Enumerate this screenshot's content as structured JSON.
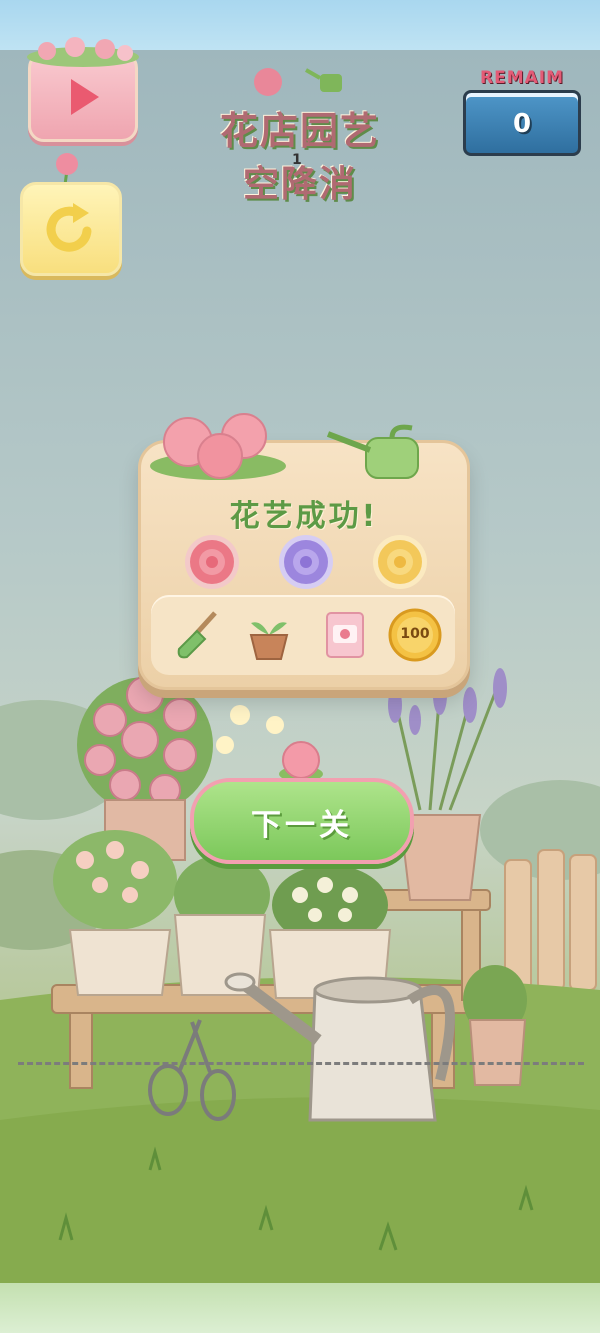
{
  "game": {
    "title_line1": "花店园艺",
    "title_line2": "空降消",
    "title_badge": "1",
    "remain_label": "REMAIM",
    "remain_value": "0"
  },
  "result": {
    "title": "花艺成功!",
    "flowers": [
      "pink-rose",
      "purple-rose",
      "yellow-rose"
    ],
    "rewards": [
      {
        "icon": "shovel-icon"
      },
      {
        "icon": "seedling-pot-icon"
      },
      {
        "icon": "seed-packet-icon"
      },
      {
        "icon": "coin-icon",
        "label": "100"
      }
    ]
  },
  "buttons": {
    "next_level": "下一关"
  },
  "colors": {
    "accent_green": "#7cc85b",
    "accent_pink": "#f2a0b0",
    "card": "#f2dcb8"
  }
}
